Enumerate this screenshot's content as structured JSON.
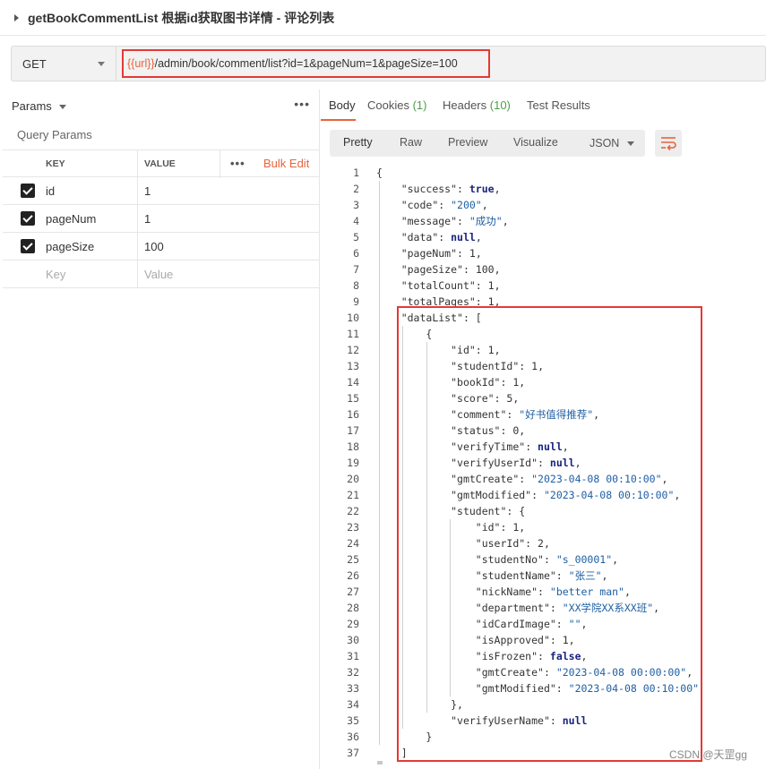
{
  "header": {
    "title": "getBookCommentList 根据id获取图书详情 - 评论列表"
  },
  "request": {
    "method": "GET",
    "url_variable": "{{url}}",
    "url_path": "/admin/book/comment/list?id=1&pageNum=1&pageSize=100"
  },
  "left": {
    "params_label": "Params",
    "more": "•••",
    "query_params_label": "Query Params",
    "col_key": "KEY",
    "col_value": "VALUE",
    "row_more": "•••",
    "bulk_edit": "Bulk Edit",
    "rows": [
      {
        "key": "id",
        "value": "1"
      },
      {
        "key": "pageNum",
        "value": "1"
      },
      {
        "key": "pageSize",
        "value": "100"
      }
    ],
    "placeholder_key": "Key",
    "placeholder_value": "Value"
  },
  "right": {
    "tabs": [
      {
        "label": "Body",
        "count": ""
      },
      {
        "label": "Cookies",
        "count": "(1)"
      },
      {
        "label": "Headers",
        "count": "(10)"
      },
      {
        "label": "Test Results",
        "count": ""
      }
    ],
    "views": [
      "Pretty",
      "Raw",
      "Preview",
      "Visualize"
    ],
    "format": "JSON"
  },
  "code_lines": [
    "{",
    "    \"success\": true,",
    "    \"code\": \"200\",",
    "    \"message\": \"成功\",",
    "    \"data\": null,",
    "    \"pageNum\": 1,",
    "    \"pageSize\": 100,",
    "    \"totalCount\": 1,",
    "    \"totalPages\": 1,",
    "    \"dataList\": [",
    "        {",
    "            \"id\": 1,",
    "            \"studentId\": 1,",
    "            \"bookId\": 1,",
    "            \"score\": 5,",
    "            \"comment\": \"好书值得推荐\",",
    "            \"status\": 0,",
    "            \"verifyTime\": null,",
    "            \"verifyUserId\": null,",
    "            \"gmtCreate\": \"2023-04-08 00:10:00\",",
    "            \"gmtModified\": \"2023-04-08 00:10:00\",",
    "            \"student\": {",
    "                \"id\": 1,",
    "                \"userId\": 2,",
    "                \"studentNo\": \"s_00001\",",
    "                \"studentName\": \"张三\",",
    "                \"nickName\": \"better man\",",
    "                \"department\": \"XX学院XX系XX班\",",
    "                \"idCardImage\": \"\",",
    "                \"isApproved\": 1,",
    "                \"isFrozen\": false,",
    "                \"gmtCreate\": \"2023-04-08 00:00:00\",",
    "                \"gmtModified\": \"2023-04-08 00:10:00\"",
    "            },",
    "            \"verifyUserName\": null",
    "        }",
    "    ]"
  ],
  "watermark": "CSDN @天罡gg",
  "colors": {
    "accent": "#e8633a",
    "highlight_border": "#e53935",
    "string": "#1f5fa3",
    "keyword": "#1a237e",
    "count": "#4a9f4a"
  }
}
